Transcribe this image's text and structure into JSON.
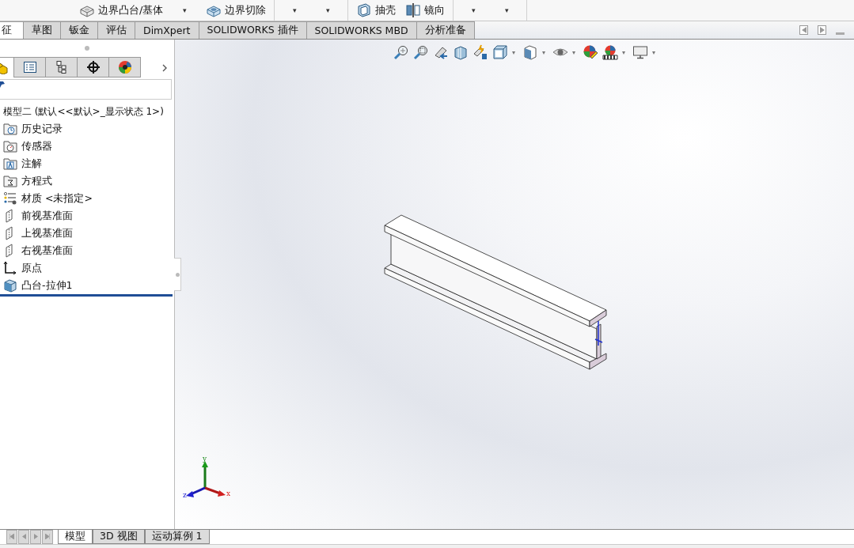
{
  "toolbar": {
    "items": [
      {
        "kind": "boss",
        "label": "边界凸台/基体"
      },
      {
        "kind": "caret",
        "label": "▾"
      },
      {
        "kind": "cut",
        "label": "边界切除"
      },
      {
        "kind": "separator"
      },
      {
        "kind": "caret",
        "label": "▾"
      },
      {
        "kind": "caret",
        "label": "▾"
      },
      {
        "kind": "separator"
      },
      {
        "kind": "shell",
        "label": "抽壳"
      },
      {
        "kind": "mirror",
        "label": "镜向"
      },
      {
        "kind": "separator"
      },
      {
        "kind": "caret",
        "label": "▾"
      },
      {
        "kind": "caret",
        "label": "▾"
      },
      {
        "kind": "separator"
      }
    ]
  },
  "command_tabs": [
    {
      "label": "征",
      "selected": true
    },
    {
      "label": "草图",
      "selected": false
    },
    {
      "label": "钣金",
      "selected": false
    },
    {
      "label": "评估",
      "selected": false
    },
    {
      "label": "DimXpert",
      "selected": false
    },
    {
      "label": "SOLIDWORKS 插件",
      "selected": false
    },
    {
      "label": "SOLIDWORKS MBD",
      "selected": false
    },
    {
      "label": "分析准备",
      "selected": false
    }
  ],
  "feature_manager": {
    "panel_tabs": [
      {
        "kind": "features",
        "selected": true
      },
      {
        "kind": "properties",
        "selected": false
      },
      {
        "kind": "configurations",
        "selected": false
      },
      {
        "kind": "dimxpert",
        "selected": false
      },
      {
        "kind": "appearance",
        "selected": false
      }
    ],
    "tree": {
      "label": "模型二  (默认<<默认>_显示状态 1>)",
      "children": [
        {
          "kind": "history",
          "label": "历史记录"
        },
        {
          "kind": "sensor",
          "label": "传感器"
        },
        {
          "kind": "annotation",
          "label": "注解"
        },
        {
          "kind": "equation",
          "label": "方程式"
        },
        {
          "kind": "material",
          "label": "材质 <未指定>"
        },
        {
          "kind": "plane",
          "label": "前视基准面"
        },
        {
          "kind": "plane",
          "label": "上视基准面"
        },
        {
          "kind": "plane",
          "label": "右视基准面"
        },
        {
          "kind": "origin",
          "label": "原点"
        },
        {
          "kind": "extrude",
          "label": "凸台-拉伸1"
        }
      ]
    }
  },
  "view_toolbar": [
    {
      "kind": "zoom-fit"
    },
    {
      "kind": "zoom-area"
    },
    {
      "kind": "previous-view"
    },
    {
      "kind": "section"
    },
    {
      "kind": "dynamic-annotation"
    },
    {
      "kind": "view-orientation"
    },
    {
      "kind": "caret",
      "label": "▾"
    },
    {
      "kind": "display-style"
    },
    {
      "kind": "caret",
      "label": "▾"
    },
    {
      "kind": "hide-show"
    },
    {
      "kind": "caret",
      "label": "▾"
    },
    {
      "kind": "edit-appearance"
    },
    {
      "kind": "scene"
    },
    {
      "kind": "caret",
      "label": "▾"
    },
    {
      "kind": "display-settings"
    },
    {
      "kind": "caret",
      "label": "▾"
    }
  ],
  "triad": {
    "x": "x",
    "y": "y",
    "z": "z"
  },
  "bottom_tabs": [
    {
      "label": "模型",
      "selected": true
    },
    {
      "label": "3D 视图",
      "selected": false
    },
    {
      "label": "运动算例 1",
      "selected": false
    }
  ]
}
